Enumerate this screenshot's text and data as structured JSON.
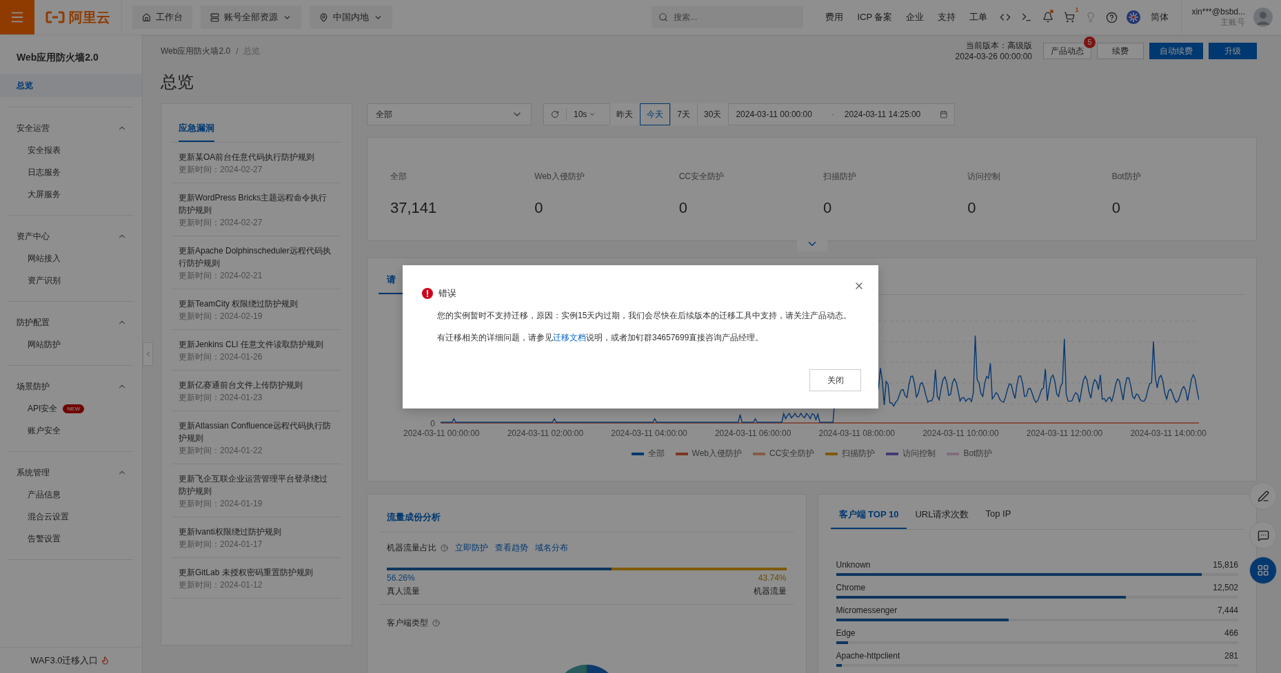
{
  "topbar": {
    "logo": "阿里云",
    "nav": [
      {
        "label": "工作台",
        "kind": "home"
      },
      {
        "label": "账号全部资源",
        "kind": "dropdown"
      },
      {
        "label": "中国内地",
        "kind": "location"
      }
    ],
    "search_placeholder": "搜索...",
    "links": [
      "费用",
      "ICP 备案",
      "企业",
      "支持",
      "工单"
    ],
    "notification_unread": true,
    "cart_count": "1",
    "language": "简体",
    "user": "xin***@bsbd...",
    "account_type": "主账号"
  },
  "sidebar": {
    "title": "Web应用防火墙2.0",
    "items": [
      {
        "label": "总览",
        "selected": true
      }
    ],
    "groups": [
      {
        "label": "安全运营",
        "expanded": true,
        "children": [
          {
            "label": "安全报表",
            "selected": false
          },
          {
            "label": "日志服务",
            "selected": false
          },
          {
            "label": "大屏服务",
            "selected": false
          }
        ]
      },
      {
        "label": "资产中心",
        "expanded": true,
        "children": [
          {
            "label": "网站接入",
            "selected": false
          },
          {
            "label": "资产识别",
            "selected": false
          }
        ]
      },
      {
        "label": "防护配置",
        "expanded": true,
        "children": [
          {
            "label": "网站防护",
            "selected": false
          }
        ]
      },
      {
        "label": "场景防护",
        "expanded": true,
        "children": [
          {
            "label": "API安全",
            "selected": false,
            "badge": "NEW"
          },
          {
            "label": "账户安全",
            "selected": false
          }
        ]
      },
      {
        "label": "系统管理",
        "expanded": true,
        "children": [
          {
            "label": "产品信息",
            "selected": false
          },
          {
            "label": "混合云设置",
            "selected": false
          },
          {
            "label": "告警设置",
            "selected": false
          }
        ]
      }
    ],
    "footer": "WAF3.0迁移入口"
  },
  "header": {
    "breadcrumb": [
      "Web应用防火墙2.0",
      "总览"
    ],
    "breadcrumb_separator": "/",
    "title": "总览",
    "version_label": "当前版本：高级版",
    "version_expiry": "2024-03-26 00:00:00",
    "buttons": [
      {
        "label": "产品动态",
        "kind": "outline",
        "badge": "5"
      },
      {
        "label": "续费",
        "kind": "outline"
      },
      {
        "label": "自动续费",
        "kind": "primary"
      },
      {
        "label": "升级",
        "kind": "primary"
      }
    ]
  },
  "vulnerabilities": {
    "tab": "应急漏洞",
    "items": [
      {
        "title": "更新某OA前台任意代码执行防护规则",
        "time": "更新时间：2024-02-27"
      },
      {
        "title": "更新WordPress Bricks主题远程命令执行防护规则",
        "time": "更新时间：2024-02-27"
      },
      {
        "title": "更新Apache Dolphinscheduler远程代码执行防护规则",
        "time": "更新时间：2024-02-21"
      },
      {
        "title": "更新TeamCity 权限绕过防护规则",
        "time": "更新时间：2024-02-19"
      },
      {
        "title": "更新Jenkins CLI 任意文件读取防护规则",
        "time": "更新时间：2024-01-26"
      },
      {
        "title": "更新亿赛通前台文件上传防护规则",
        "time": "更新时间：2024-01-23"
      },
      {
        "title": "更新Atlassian Confluence远程代码执行防护规则",
        "time": "更新时间：2024-01-22"
      },
      {
        "title": "更新飞企互联企业运营管理平台登录绕过防护规则",
        "time": "更新时间：2024-01-19"
      },
      {
        "title": "更新Ivanti权限绕过防护规则",
        "time": "更新时间：2024-01-17"
      },
      {
        "title": "更新GitLab 未授权密码重置防护规则",
        "time": "更新时间：2024-01-12"
      }
    ]
  },
  "filters": {
    "scope": "全部",
    "refresh": "10s",
    "ranges": [
      {
        "label": "昨天",
        "selected": false
      },
      {
        "label": "今天",
        "selected": true
      },
      {
        "label": "7天",
        "selected": false
      },
      {
        "label": "30天",
        "selected": false
      }
    ],
    "start": "2024-03-11 00:00:00",
    "separator": "-",
    "end": "2024-03-11 14:25:00"
  },
  "stats_expanded": false,
  "stats": [
    {
      "label": "全部",
      "value": "37,141"
    },
    {
      "label": "Web入侵防护",
      "value": "0"
    },
    {
      "label": "CC安全防护",
      "value": "0"
    },
    {
      "label": "扫描防护",
      "value": "0"
    },
    {
      "label": "访问控制",
      "value": "0"
    },
    {
      "label": "Bot防护",
      "value": "0"
    }
  ],
  "request_chart": {
    "tab": "请",
    "y_label": "0",
    "x_labels": [
      "2024-03-11 00:00:00",
      "2024-03-11 02:00:00",
      "2024-03-11 04:00:00",
      "2024-03-11 06:00:00",
      "2024-03-11 08:00:00",
      "2024-03-11 10:00:00",
      "2024-03-11 12:00:00",
      "2024-03-11 14:00:00"
    ],
    "legend": [
      {
        "name": "全部",
        "color": "#063870"
      },
      {
        "name": "Web入侵防护",
        "color": "#7f3622"
      },
      {
        "name": "CC安全防护",
        "color": "#855b47"
      },
      {
        "name": "扫描防护",
        "color": "#7f5b00"
      },
      {
        "name": "访问控制",
        "color": "#443978"
      },
      {
        "name": "Bot防护",
        "color": "#816d7f"
      }
    ]
  },
  "traffic": {
    "title": "流量成份分析",
    "ratio_label": "机器流量占比",
    "links": [
      "立即防护",
      "查看趋势",
      "域名分布"
    ],
    "level": 0.5626,
    "human_share": "56.26%",
    "machine_share": "43.74%",
    "human_label": "真人流量",
    "machine_label": "机器流量",
    "client_type_label": "客户端类型"
  },
  "clients": {
    "tabs": [
      {
        "label": "客户端 TOP 10",
        "selected": true
      },
      {
        "label": "URL请求次数",
        "selected": false
      },
      {
        "label": "Top IP",
        "selected": false
      }
    ],
    "rows": [
      {
        "name": "Unknown",
        "count": "15,816",
        "level": 0.91
      },
      {
        "name": "Chrome",
        "count": "12,502",
        "level": 0.72
      },
      {
        "name": "Micromessenger",
        "count": "7,444",
        "level": 0.43
      },
      {
        "name": "Edge",
        "count": "466",
        "level": 0.03
      },
      {
        "name": "Apache-httpclient",
        "count": "281",
        "level": 0.015
      }
    ]
  },
  "dialog": {
    "title": "错误",
    "message": "您的实例暂时不支持迁移，原因：实例15天内过期，我们会尽快在后续版本的迁移工具中支持，请关注产品动态。",
    "help_before": "有迁移相关的详细问题，请参见",
    "help_link": "迁移文档",
    "help_after": "说明，或者加钉群34657699直接咨询产品经理。",
    "button": "关闭"
  }
}
